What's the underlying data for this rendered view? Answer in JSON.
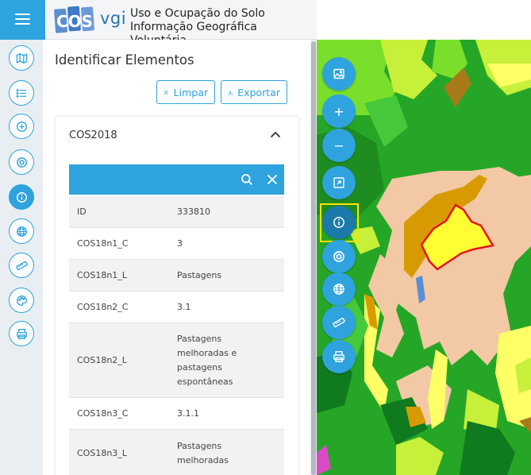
{
  "header": {
    "logo_text_1": "COS",
    "logo_text_2": "vgi",
    "title_line1": "Uso e Ocupação do Solo",
    "title_line2": "Informação Geográfica Voluntária"
  },
  "rail": {
    "icons": [
      "map-icon",
      "list-icon",
      "add-circle-icon",
      "target-icon",
      "info-icon",
      "globe-icon",
      "ruler-icon",
      "palette-icon",
      "print-icon"
    ],
    "active_index": 4
  },
  "panel": {
    "title": "Identificar Elementos",
    "clear_label": "Limpar",
    "export_label": "Exportar",
    "layer_title": "COS2018",
    "rows": [
      {
        "key": "ID",
        "value": "333810"
      },
      {
        "key": "COS18n1_C",
        "value": "3"
      },
      {
        "key": "COS18n1_L",
        "value": "Pastagens"
      },
      {
        "key": "COS18n2_C",
        "value": "3.1"
      },
      {
        "key": "COS18n2_L",
        "value": "Pastagens melhoradas e pastagens espontâneas"
      },
      {
        "key": "COS18n3_C",
        "value": "3.1.1"
      },
      {
        "key": "COS18n3_L",
        "value": "Pastagens melhoradas"
      }
    ]
  },
  "map_toolbar": {
    "zoom_in": "+",
    "zoom_out": "−",
    "icons": [
      "image-icon",
      "zoom-in-icon",
      "zoom-out-icon",
      "zoom-extent-icon",
      "info-icon",
      "target-icon",
      "globe-icon",
      "ruler-icon",
      "print-icon"
    ],
    "active_tool": "info-icon"
  },
  "colors": {
    "primary": "#2ea3dd",
    "active_tool": "#1c7aaa",
    "highlight_border": "#ffe100",
    "selected_feature": "#e8141c"
  }
}
